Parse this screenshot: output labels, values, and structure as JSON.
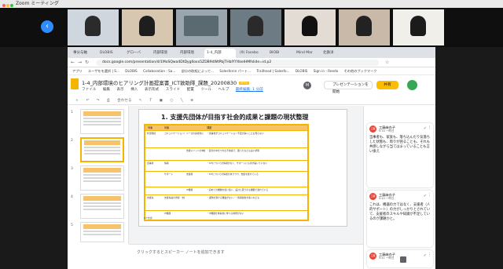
{
  "zoom": {
    "title": "Zoom ミーティング",
    "dot_colors": [
      "#ff5f57",
      "#febc2e",
      "#28c840"
    ]
  },
  "participants": [
    {
      "bg": "#cfd6dd",
      "skin": "#2b2b2b"
    },
    {
      "bg": "#d8c7b0",
      "skin": "#1e1e1e"
    },
    {
      "bg": "#9ba5ad",
      "skin": "#3a3a3a"
    },
    {
      "bg": "#6d7c84",
      "skin": "#2a2a2a"
    },
    {
      "bg": "#e2dcd4",
      "skin": "#111111"
    },
    {
      "bg": "#3a3b3c",
      "skin": "#222222"
    },
    {
      "bg": "#f0efea",
      "skin": "#1b1b1b"
    }
  ],
  "browser": {
    "tabs": [
      "事分与軸",
      "DLOBIS",
      "グローバ",
      "内部環境",
      "内部環境",
      "1-4_内部",
      "(9) Facebo",
      "BIOBI",
      "Mind Mar",
      "北鉄洋",
      ""
    ],
    "url": "docs.google.com/presentation/d/1MoSQwa4DtDyg0oxx5ZDB9dWtPbjTHbIYYXkelHMfslide=id.p2",
    "bookmarks": [
      "アプリ",
      "ユーザをを選択 | S...",
      "DLOBIS",
      "Collaboration - Sa...",
      "部分の取組によって...",
      "Salesforce パート...",
      "Trailhead | Salesfo...",
      "DLOBIS",
      "Sign in - Reedo",
      "その他のブックマーク"
    ]
  },
  "slides": {
    "doc_title": "1-4_内部環境のヒアリング計画提案書_ICT敦助隊_課題_20200830",
    "badge": "PPTX",
    "menu": [
      "ファイル",
      "編集",
      "表示",
      "挿入",
      "表示形式",
      "スライド",
      "配置",
      "ツール",
      "ヘルプ"
    ],
    "last_edit": "最終編集: 1 分前",
    "present_label": "プレゼンテーションを開始",
    "share_label": "共有",
    "avatar_letter": "M",
    "thumb_numbers": [
      "1",
      "2",
      "3",
      "4",
      "5",
      "6"
    ],
    "slide_title": "1. 支援先団体が目指す社会的成果と課題の現状整理",
    "table_head": [
      "対象",
      "対象",
      "",
      "課題"
    ],
    "table_rows": [
      [
        "外部環境",
        "コミュニケーション支援の不足",
        "ニーズの多様化に",
        "・当事者がコミュニケーション不足が多いことも知らない"
      ],
      [
        "",
        "",
        "支援メソッドの未確立",
        "・自分の中をつかむ不快感で、困ったなども良い状態"
      ],
      [
        "自事者",
        "情報",
        "",
        "・ICTについての情報がなく、サポートにも手が届いていない"
      ],
      [
        "",
        "サポート",
        "支援者",
        "・ICTについての情報がありつつ、支援を受けている"
      ],
      [
        "",
        "",
        "IT機器",
        "・初めての機種を使い使い、設計に思うのも機器で遅れている"
      ],
      [
        "支援先",
        "支援先員の習得・支援",
        "",
        "・課題を受ける機会がない／・情報提供が多いなども"
      ],
      [
        "",
        "IT機器",
        "",
        "・IT機器を体系的に学べる場所がない"
      ]
    ],
    "logo_text": "ICT支援",
    "notes_placeholder": "クリックするとスピーカー ノートを追加できます",
    "toolbar_zoom": "合わせる"
  },
  "comments": [
    {
      "avatar": "工藤",
      "author": "工藤麻衣子",
      "time": "9:34 一昨日",
      "body": "当事者も、家族も、落ち込んだり気落ちした状態も、周りが困ることも、それも共感しながら当てはまっていることも言い換え"
    },
    {
      "avatar": "工藤",
      "author": "工藤麻衣子",
      "time": "9:40 一昨日",
      "body": "これは、機器の力ではなく、支援者（人的サポート）の力がしっかりとされていて、支援者のスキルや知識が不足しているのが課題かと。"
    },
    {
      "avatar": "工藤",
      "author": "工藤麻衣子",
      "time": "9:41 一昨日",
      "body": ""
    }
  ]
}
